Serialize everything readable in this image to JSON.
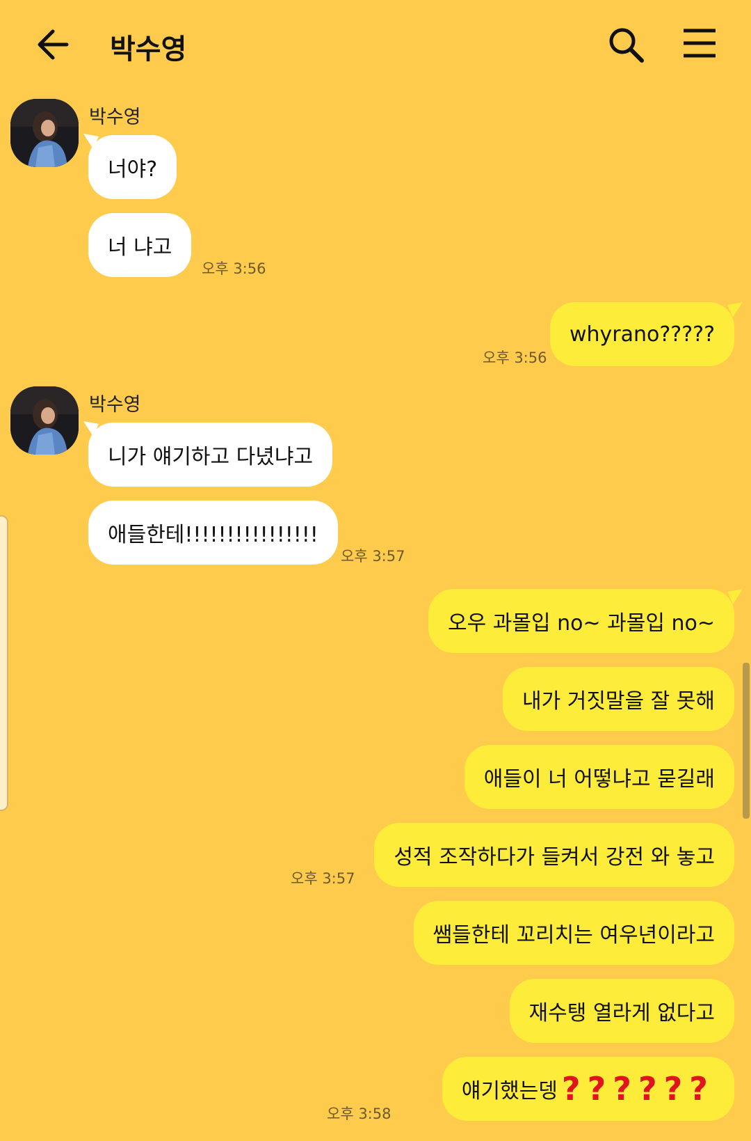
{
  "header": {
    "title": "박수영",
    "back_icon": "arrow-left-icon",
    "search_icon": "search-icon",
    "menu_icon": "hamburger-menu-icon"
  },
  "colors": {
    "background": "#FECB4C",
    "incoming_bubble": "#FFFFFF",
    "outgoing_bubble": "#FEEC3A",
    "question_mark": "#E0141E"
  },
  "groups": [
    {
      "sender": "박수영",
      "messages": [
        "너야?",
        "너 냐고"
      ],
      "time": "오후 3:56"
    },
    {
      "sender": "me",
      "messages": [
        "whyrano?????"
      ],
      "time": "오후 3:56"
    },
    {
      "sender": "박수영",
      "messages": [
        "니가 얘기하고 다녔냐고",
        "애들한테!!!!!!!!!!!!!!!!"
      ],
      "time": "오후 3:57"
    },
    {
      "sender": "me",
      "messages": [
        "오우 과몰입 no~ 과몰입 no~",
        "내가 거짓말을 잘 못해",
        "애들이 너 어떻냐고 묻길래",
        "성적 조작하다가 들켜서 강전 와 놓고"
      ],
      "time": "오후 3:57"
    },
    {
      "sender": "me",
      "messages": [
        "쌤들한테 꼬리치는 여우년이라고",
        "재수탱 열라게 없다고",
        "얘기했는뎅"
      ],
      "question_marks": "??????",
      "time": "오후 3:58"
    }
  ]
}
